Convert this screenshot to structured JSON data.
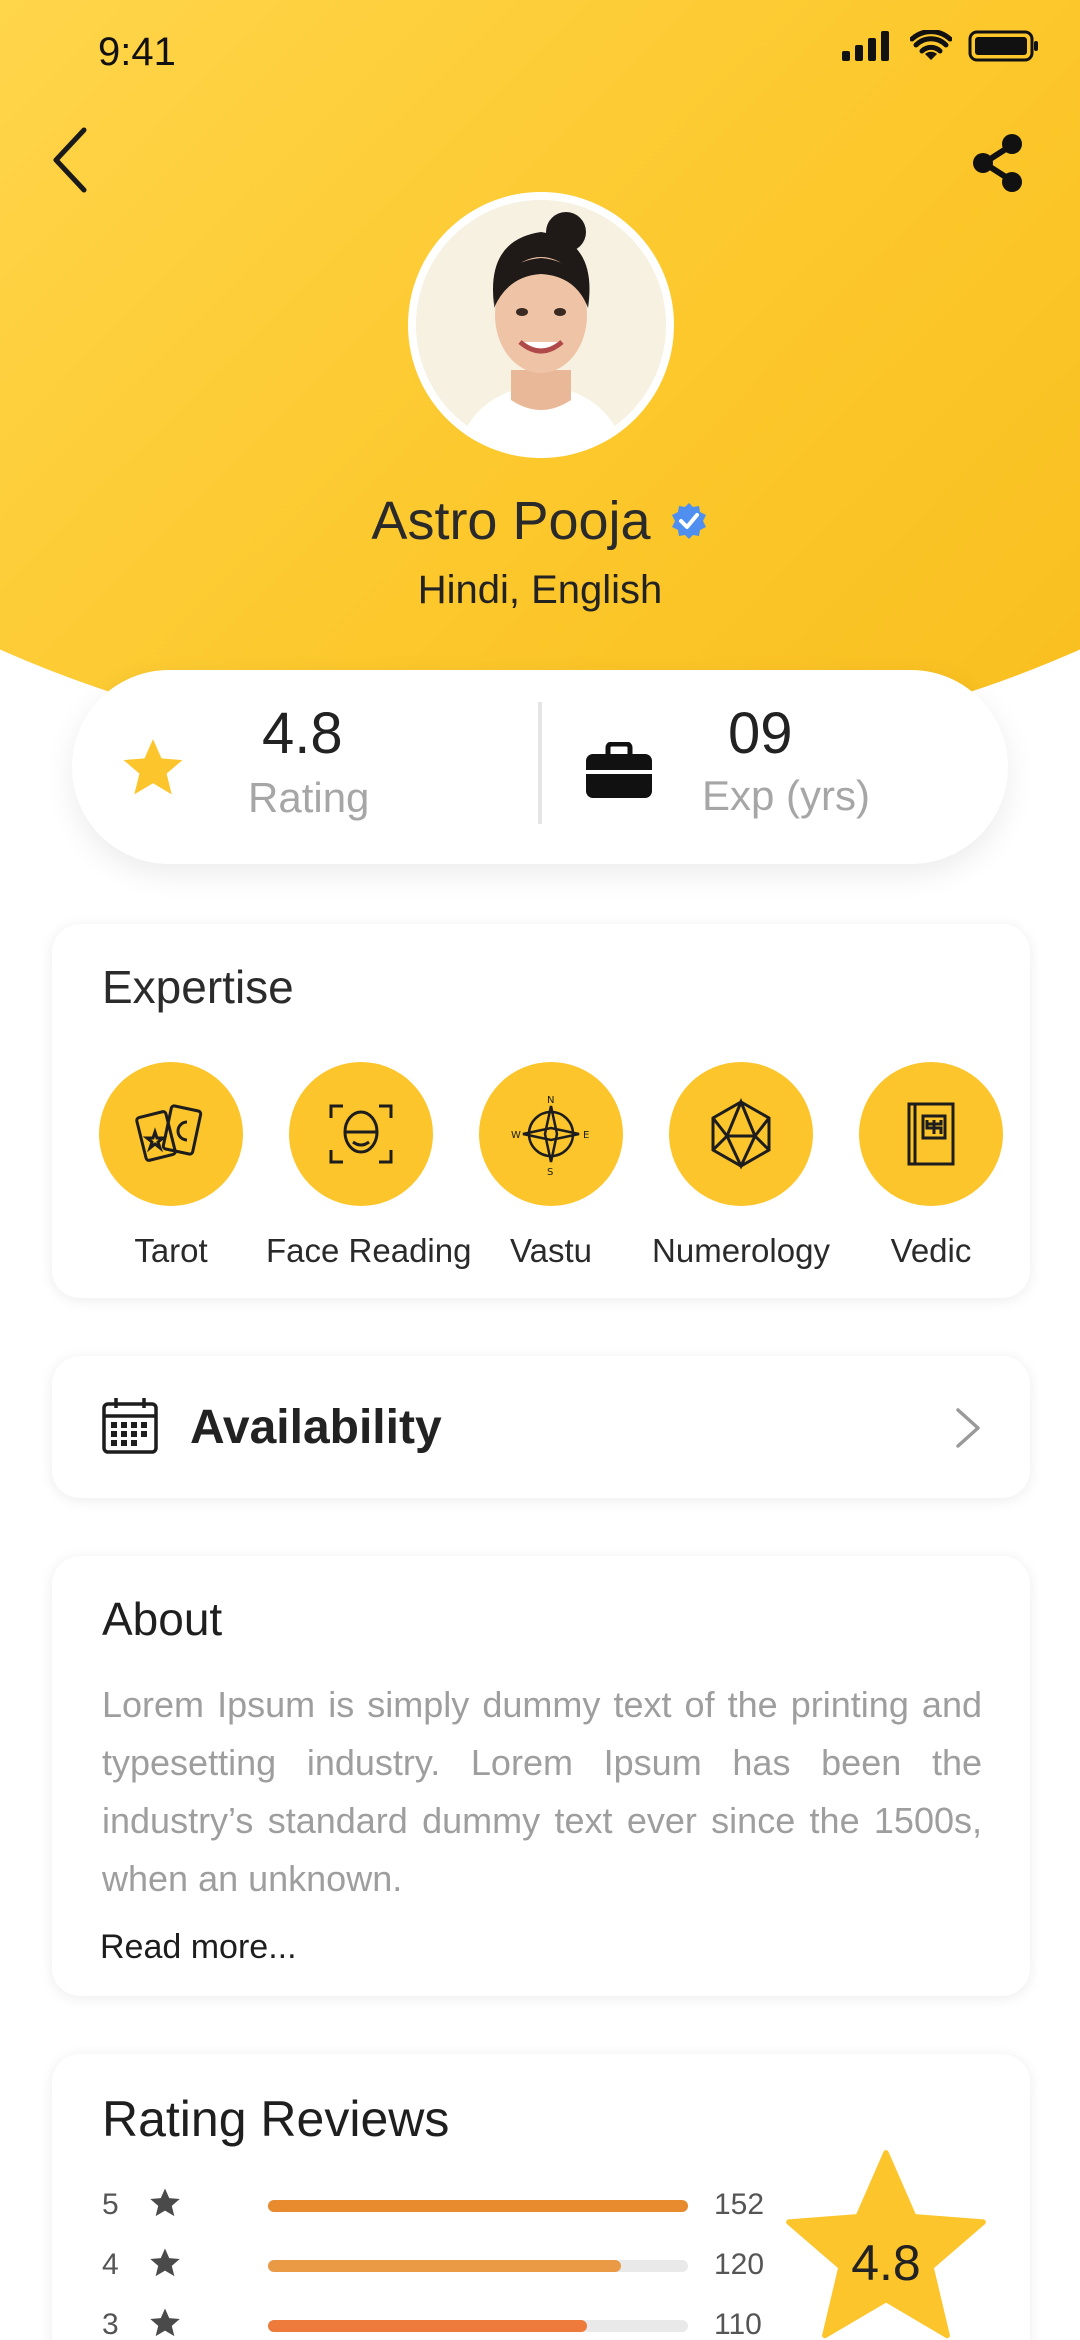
{
  "status": {
    "time": "9:41"
  },
  "profile": {
    "name": "Astro Pooja",
    "languages": "Hindi, English"
  },
  "stats": {
    "rating_value": "4.8",
    "rating_label": "Rating",
    "exp_value": "09",
    "exp_label": "Exp (yrs)"
  },
  "expertise": {
    "title": "Expertise",
    "items": [
      {
        "label": "Tarot",
        "icon": "tarot-cards-icon"
      },
      {
        "label": "Face Reading",
        "icon": "face-scan-icon"
      },
      {
        "label": "Vastu",
        "icon": "compass-icon"
      },
      {
        "label": "Numerology",
        "icon": "dice-icon"
      },
      {
        "label": "Vedic",
        "icon": "book-icon"
      }
    ]
  },
  "availability": {
    "label": "Availability"
  },
  "about": {
    "title": "About",
    "text": "Lorem Ipsum is simply dummy text of the printing and typesetting industry. Lorem Ipsum has been the industry’s standard dummy text ever since the 1500s, when an unknown.",
    "read_more": "Read more..."
  },
  "reviews": {
    "title": "Rating Reviews",
    "overall": "4.8",
    "rows": [
      {
        "stars": "5",
        "count": "152",
        "fill": 1.0,
        "color": "#e88a2e"
      },
      {
        "stars": "4",
        "count": "120",
        "fill": 0.84,
        "color": "#ea9a45"
      },
      {
        "stars": "3",
        "count": "110",
        "fill": 0.76,
        "color": "#ee7a3c"
      }
    ]
  },
  "colors": {
    "accent": "#fcc52c",
    "verified": "#4e8ff0"
  }
}
